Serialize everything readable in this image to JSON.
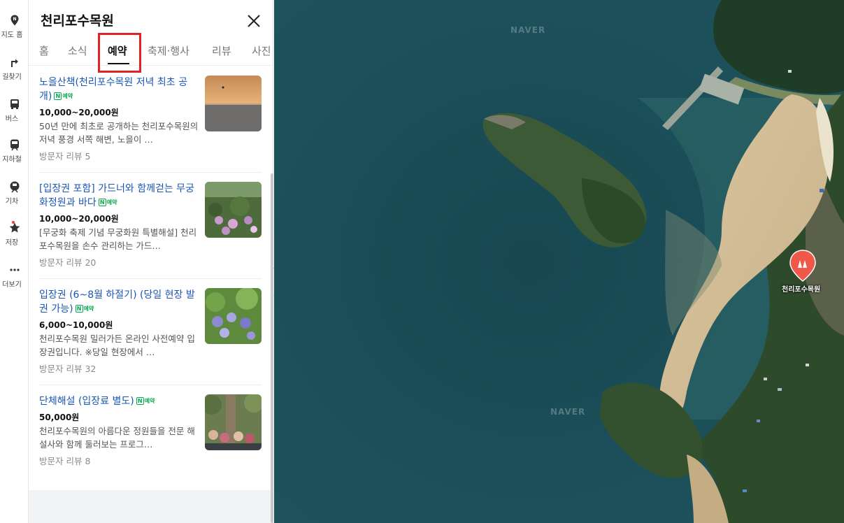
{
  "rail": {
    "items": [
      {
        "label": "지도 홈",
        "icon": "map-pin-icon"
      },
      {
        "label": "길찾기",
        "icon": "directions-icon"
      },
      {
        "label": "버스",
        "icon": "bus-icon"
      },
      {
        "label": "지하철",
        "icon": "subway-icon"
      },
      {
        "label": "기차",
        "icon": "train-icon"
      },
      {
        "label": "저장",
        "icon": "star-icon"
      },
      {
        "label": "더보기",
        "icon": "more-icon"
      }
    ]
  },
  "panel": {
    "title": "천리포수목원",
    "tabs": [
      "홈",
      "소식",
      "예약",
      "축제·행사",
      "리뷰",
      "사진"
    ],
    "active_tab": "예약",
    "badge_text": "예약",
    "badge_logo": "N"
  },
  "items": [
    {
      "title": "노을산책(천리포수목원 저녁 최초 공개)",
      "price": "10,000~20,000원",
      "desc": "50년 만에 최초로 공개하는 천리포수목원의 저녁 풍경 서쪽 해변, 노을이 …",
      "reviews": "방문자 리뷰 5"
    },
    {
      "title": "[입장권 포함] 가드너와 함께걷는 무궁화정원과 바다",
      "price": "10,000~20,000원",
      "desc": "[무궁화 축제 기념 무궁화원 특별해설] 천리포수목원을 손수 관리하는 가드…",
      "reviews": "방문자 리뷰 20"
    },
    {
      "title": "입장권 (6~8월 하절기) (당일 현장 발권 가능)",
      "price": "6,000~10,000원",
      "desc": "천리포수목원 밀러가든 온라인 사전예약 입장권입니다. ※당일 현장에서 …",
      "reviews": "방문자 리뷰 32"
    },
    {
      "title": "단체해설 (입장료 별도)",
      "price": "50,000원",
      "desc": "천리포수목원의 아름다운 정원들을 전문 해설사와 함께 둘러보는 프로그…",
      "reviews": "방문자 리뷰 8"
    }
  ],
  "map": {
    "watermark": "NAVER",
    "marker_label": "천리포수목원",
    "marker_color": "#f0594a"
  }
}
